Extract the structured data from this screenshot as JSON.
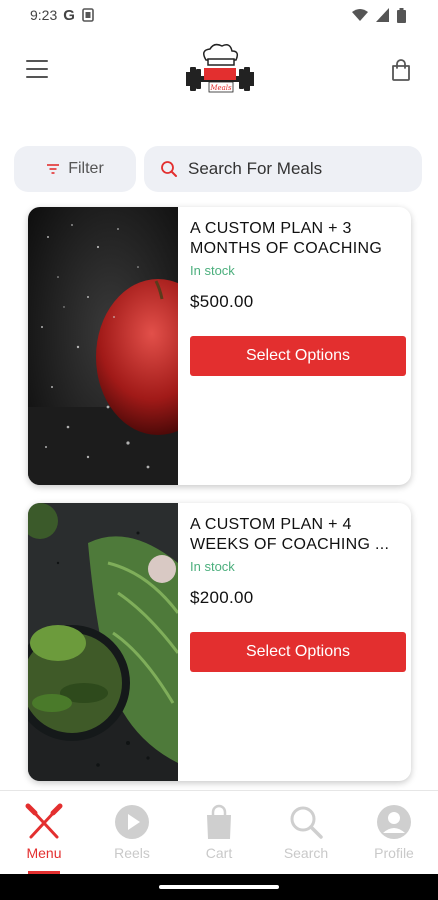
{
  "status_bar": {
    "time": "9:23",
    "g_label": "G"
  },
  "header": {
    "logo_alt": "Meals"
  },
  "search": {
    "filter_label": "Filter",
    "placeholder": "Search For Meals"
  },
  "products": [
    {
      "title": "A CUSTOM PLAN + 3 MONTHS OF COACHING",
      "stock": "In stock",
      "price": "$500.00",
      "button": "Select Options"
    },
    {
      "title": "A CUSTOM PLAN + 4 WEEKS OF COACHING ...",
      "stock": "In stock",
      "price": "$200.00",
      "button": "Select Options"
    }
  ],
  "nav": {
    "items": [
      {
        "label": "Menu",
        "active": true
      },
      {
        "label": "Reels"
      },
      {
        "label": "Cart"
      },
      {
        "label": "Search"
      },
      {
        "label": "Profile"
      }
    ]
  },
  "colors": {
    "accent": "#e32f2f",
    "stock": "#4caf7d",
    "input_bg": "#eef0f5",
    "nav_inactive": "#c9c9c9"
  },
  "icons": [
    "menu-icon",
    "logo",
    "shopping-bag-icon",
    "filter-icon",
    "search-icon",
    "cutlery-icon",
    "play-icon",
    "bag-icon",
    "search-icon",
    "profile-icon"
  ]
}
